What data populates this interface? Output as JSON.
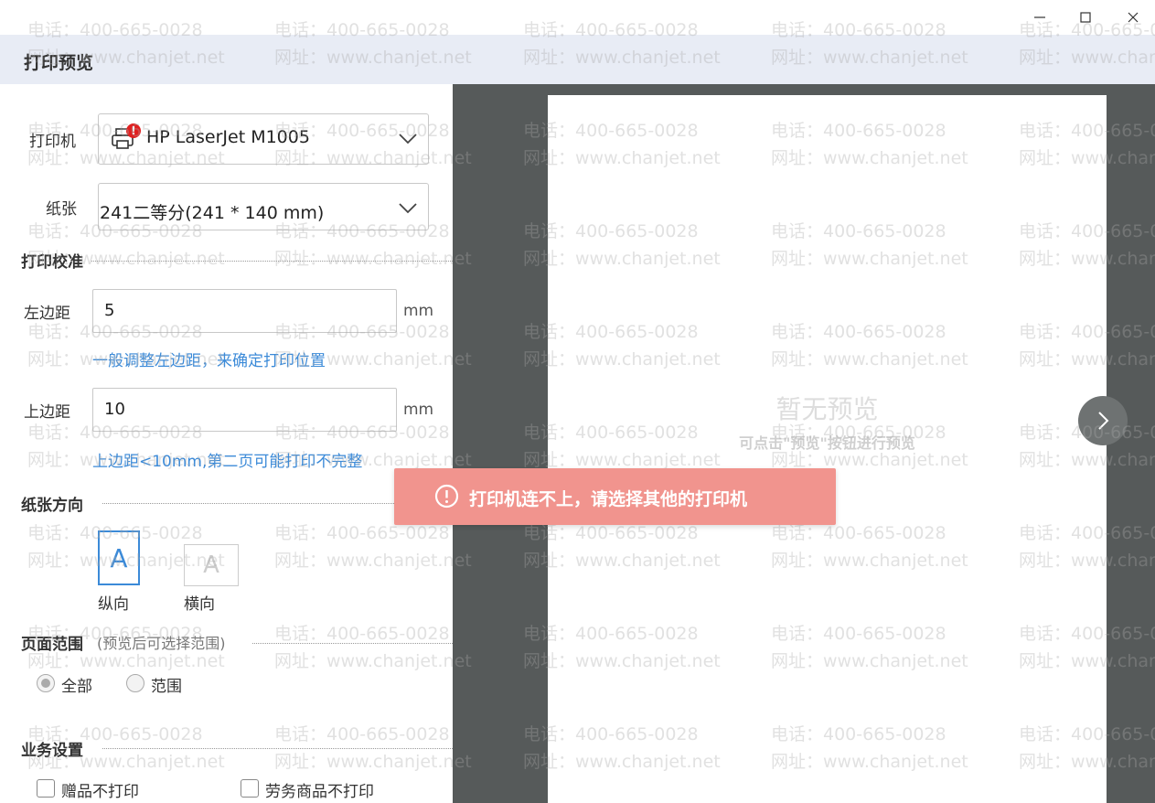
{
  "window": {
    "minimize": "—",
    "maximize": "☐",
    "close": "✕"
  },
  "header": {
    "title": "打印预览"
  },
  "printer": {
    "label": "打印机",
    "value": "HP LaserJet M1005",
    "badge": "!"
  },
  "paper": {
    "label": "纸张",
    "value": "241二等分(241  * 140  mm)"
  },
  "calibration": {
    "title": "打印校准",
    "left_margin": {
      "label": "左边距",
      "value": "5",
      "unit": "mm",
      "hint": "一般调整左边距，来确定打印位置"
    },
    "top_margin": {
      "label": "上边距",
      "value": "10",
      "unit": "mm",
      "hint": "上边距<10mm,第二页可能打印不完整"
    }
  },
  "orientation": {
    "title": "纸张方向",
    "portrait": {
      "glyph": "A",
      "label": "纵向",
      "selected": true
    },
    "landscape": {
      "glyph": "A",
      "label": "横向",
      "selected": false
    }
  },
  "page_range": {
    "title": "页面范围",
    "note": "(预览后可选择范围)",
    "options": [
      {
        "label": "全部",
        "selected": true
      },
      {
        "label": "范围",
        "selected": false
      }
    ]
  },
  "business": {
    "title": "业务设置",
    "options": [
      {
        "label": "赠品不打印",
        "checked": false
      },
      {
        "label": "劳务商品不打印",
        "checked": false
      }
    ]
  },
  "preview": {
    "empty_title": "暂无预览",
    "empty_hint": "可点击\"预览\"按钮进行预览"
  },
  "toast": {
    "icon": "!",
    "message": "打印机连不上，请选择其他的打印机"
  },
  "watermark": {
    "phone": "电话：400-665-0028",
    "site": "网址：www.chanjet.net"
  },
  "colors": {
    "accent": "#3b8ad8",
    "toast_bg": "#f1948e",
    "header_bg": "#e8ecf5",
    "preview_bg": "#565a5a",
    "badge": "#e02020"
  }
}
